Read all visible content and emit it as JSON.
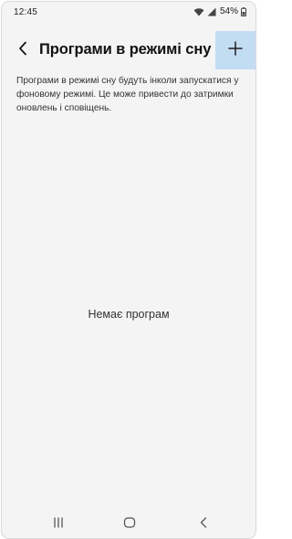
{
  "status_bar": {
    "time": "12:45",
    "battery": "54%"
  },
  "header": {
    "title": "Програми в режимі сну",
    "back_icon": "chevron-left-icon",
    "add_icon": "plus-icon",
    "add_button_color": "#c2dcf2"
  },
  "main": {
    "description": "Програми в режимі сну будуть інколи запускатися у фоновому режимі. Це може привести до затримки оновлень і сповіщень.",
    "empty_state": "Немає програм"
  },
  "nav_bar": {
    "icons": [
      "recents-icon",
      "home-icon",
      "back-icon"
    ]
  }
}
